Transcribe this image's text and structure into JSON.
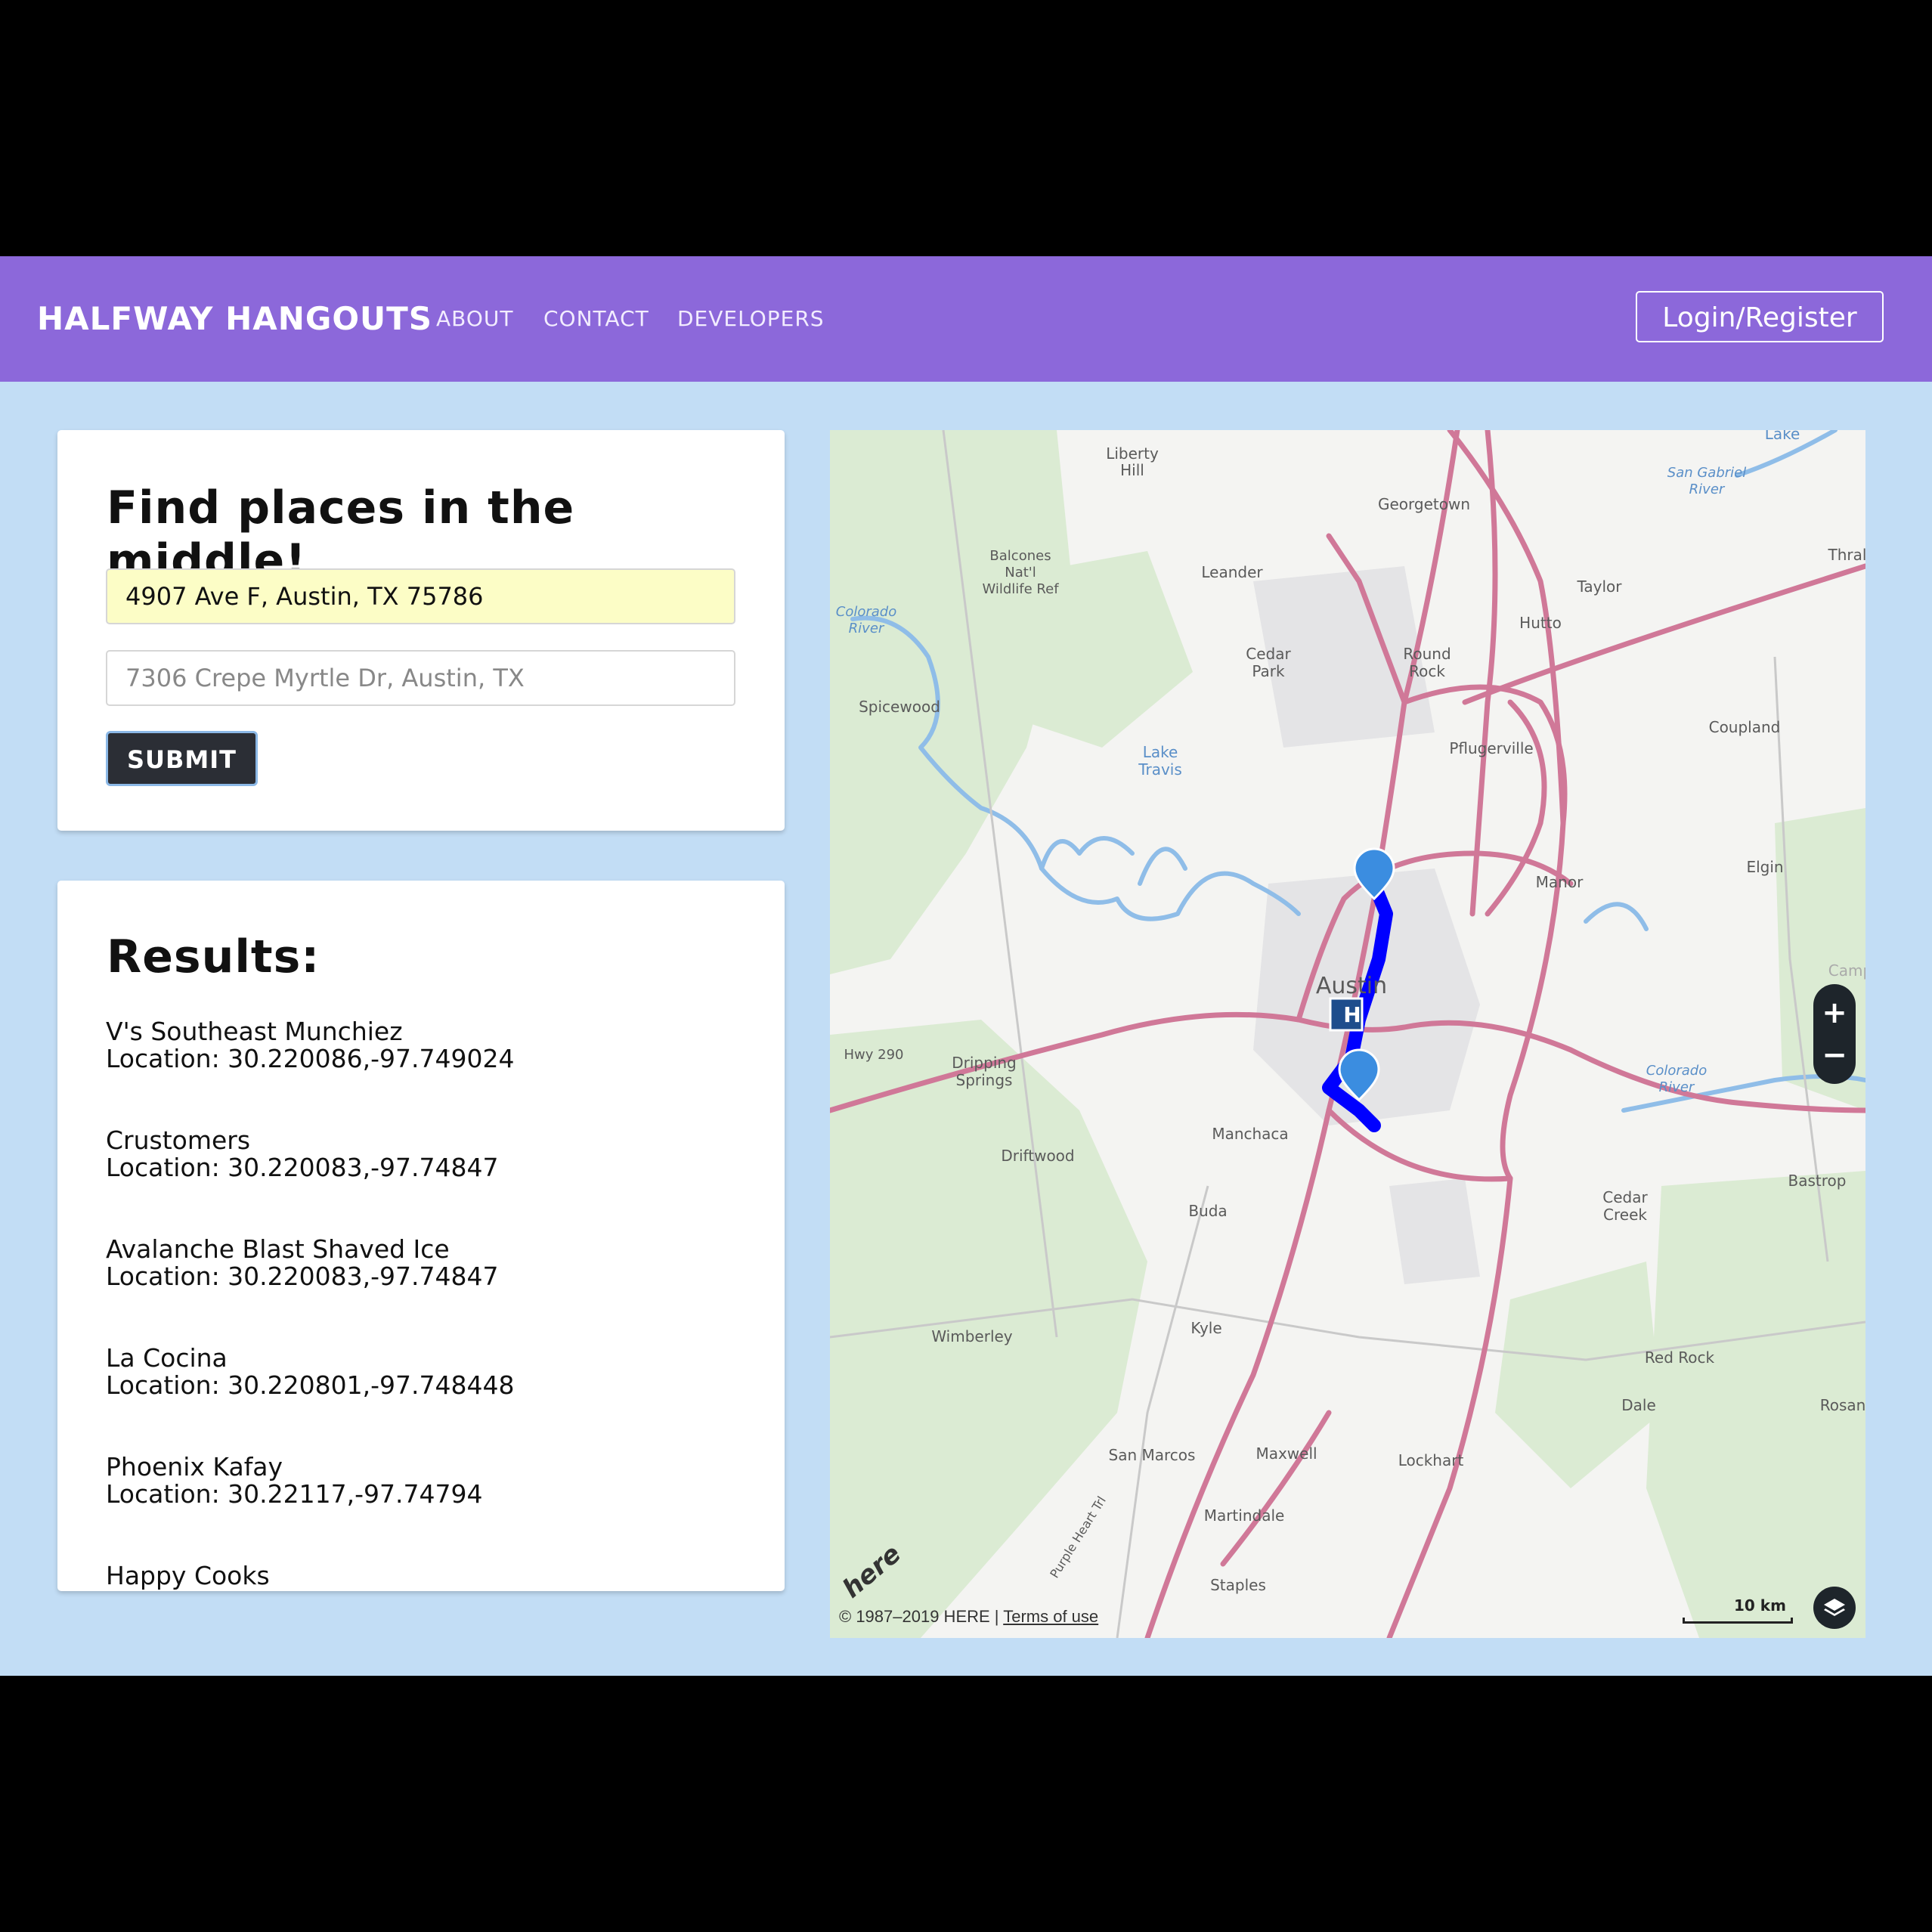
{
  "navbar": {
    "brand": "HALFWAY HANGOUTS",
    "links": [
      "ABOUT",
      "CONTACT",
      "DEVELOPERS"
    ],
    "login_label": "Login/Register"
  },
  "search": {
    "title": "Find places in the middle!",
    "address_1_value": "4907 Ave F, Austin, TX 75786",
    "address_2_placeholder": "7306 Crepe Myrtle Dr, Austin, TX",
    "submit_label": "SUBMIT"
  },
  "results": {
    "title": "Results:",
    "items": [
      {
        "name": "V's Southeast Munchiez",
        "location": "Location: 30.220086,-97.749024"
      },
      {
        "name": "Crustomers",
        "location": "Location: 30.220083,-97.74847"
      },
      {
        "name": "Avalanche Blast Shaved Ice",
        "location": "Location: 30.220083,-97.74847"
      },
      {
        "name": "La Cocina",
        "location": "Location: 30.220801,-97.748448"
      },
      {
        "name": "Phoenix Kafay",
        "location": "Location: 30.22117,-97.74794"
      },
      {
        "name": "Happy Cooks",
        "location": ""
      }
    ]
  },
  "map": {
    "zoom_in": "+",
    "zoom_out": "−",
    "attribution": "© 1987–2019 HERE | ",
    "terms": "Terms of use",
    "scale": "10 km",
    "logo": "here",
    "midpoint_marker": "H",
    "place_labels": [
      "Liberty Hill",
      "Georgetown",
      "Leander",
      "Cedar Park",
      "Round Rock",
      "Taylor",
      "Hutto",
      "Pflugerville",
      "Coupland",
      "Spicewood",
      "Lake Travis",
      "Manor",
      "Elgin",
      "Austin",
      "Dripping Springs",
      "Manchaca",
      "Driftwood",
      "Buda",
      "Cedar Creek",
      "Bastrop",
      "Kyle",
      "Wimberley",
      "Red Rock",
      "Dale",
      "Rosan",
      "San Marcos",
      "Maxwell",
      "Lockhart",
      "Martindale",
      "Staples",
      "Balcones Nat'l Wildlife Ref",
      "Colorado River",
      "San Gabriel River",
      "Thral",
      "Lake",
      "Camp",
      "Hwy 290",
      "Purple Heart Trl"
    ],
    "accent_route": "#0000ff",
    "accent_highway": "#d07898",
    "accent_marker": "#3b8de0"
  }
}
